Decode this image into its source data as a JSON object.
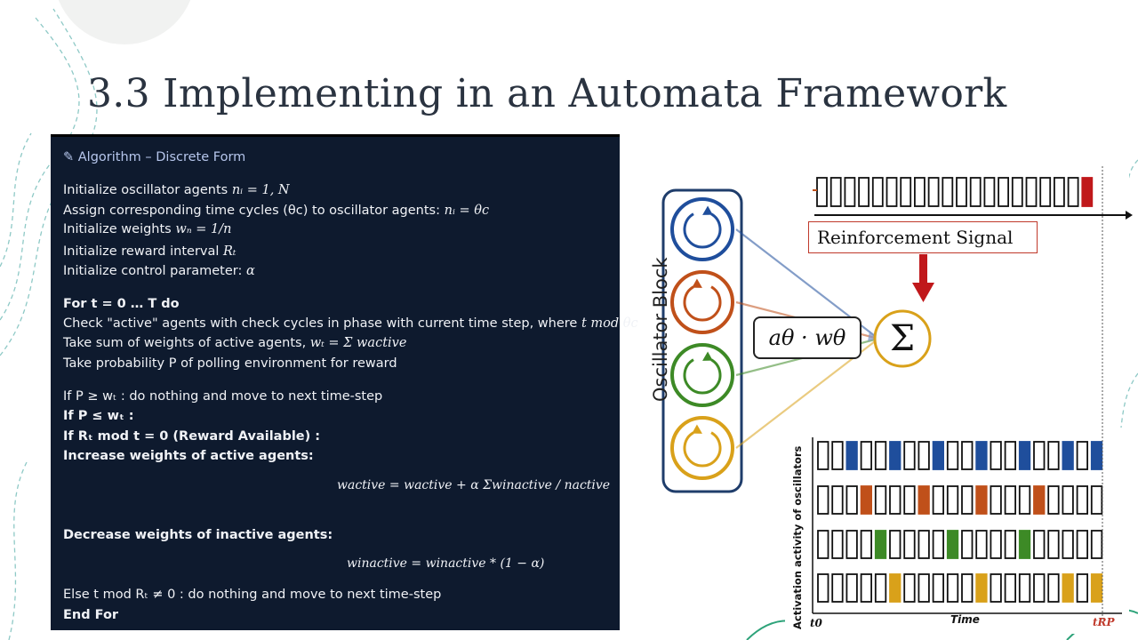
{
  "slide": {
    "title": "3.3 Implementing in an Automata Framework"
  },
  "algorithm": {
    "header": "Algorithm – Discrete Form",
    "lines": [
      {
        "text": "Initialize oscillator agents ",
        "math": "nᵢ = 1, N"
      },
      {
        "text": "Assign corresponding time cycles (θc) to oscillator agents: ",
        "math": "nᵢ = θc"
      },
      {
        "text": "Initialize weights ",
        "math": "wₙ = 1/n"
      },
      {
        "text": "Initialize reward interval ",
        "math": "Rₜ"
      },
      {
        "text": "Initialize control parameter: ",
        "math": "α"
      },
      {
        "text": "For t = 0 … T do"
      },
      {
        "text": "Check \"active\" agents with check cycles in phase with current time step, where ",
        "math": "t mod θc = 0"
      },
      {
        "text": "Take sum of weights of active agents, ",
        "math": "wₜ = Σ wactive"
      },
      {
        "text": "Take probability P of polling environment for reward"
      },
      {
        "text": "If P ≥ wₜ : do nothing and move to next time-step"
      },
      {
        "text": "If P ≤ wₜ :"
      },
      {
        "text": "If Rₜ mod t = 0 (Reward Available) :"
      },
      {
        "text": "Increase weights of active agents:"
      },
      {
        "text": "wactive = wactive + α Σwinactive / nactive"
      },
      {
        "text": "Decrease weights of inactive agents:"
      },
      {
        "text": "winactive = winactive * (1 − α)"
      },
      {
        "text": "Else t mod Rₜ ≠ 0 : do nothing and move to next time-step"
      },
      {
        "text": "End For"
      }
    ]
  },
  "diagram": {
    "oscillator_block_label": "Oscillator Block",
    "reinforcement_label": "Reinforcement Signal",
    "weight_label": "aθ · wθ",
    "sum_symbol": "Σ",
    "y_axis_label": "Activation activity of oscillators",
    "time_label": "Time",
    "t0_label": "t0",
    "trp_label": "tRP",
    "oscillator_colors": [
      "#1f4e9c",
      "#c0501a",
      "#3d8a26",
      "#d9a11a"
    ],
    "reinforcement_color": "#c0181b",
    "reinforcement_row": [
      0,
      0,
      0,
      0,
      0,
      0,
      0,
      0,
      0,
      0,
      0,
      0,
      0,
      0,
      0,
      0,
      0,
      0,
      0,
      1
    ],
    "activation_rows": [
      [
        0,
        0,
        1,
        0,
        0,
        1,
        0,
        0,
        1,
        0,
        0,
        1,
        0,
        0,
        1,
        0,
        0,
        1,
        0,
        1
      ],
      [
        0,
        0,
        0,
        1,
        0,
        0,
        0,
        1,
        0,
        0,
        0,
        1,
        0,
        0,
        0,
        1,
        0,
        0,
        0,
        0
      ],
      [
        0,
        0,
        0,
        0,
        1,
        0,
        0,
        0,
        0,
        1,
        0,
        0,
        0,
        0,
        1,
        0,
        0,
        0,
        0,
        0
      ],
      [
        0,
        0,
        0,
        0,
        0,
        1,
        0,
        0,
        0,
        0,
        0,
        1,
        0,
        0,
        0,
        0,
        0,
        1,
        0,
        1
      ]
    ]
  }
}
